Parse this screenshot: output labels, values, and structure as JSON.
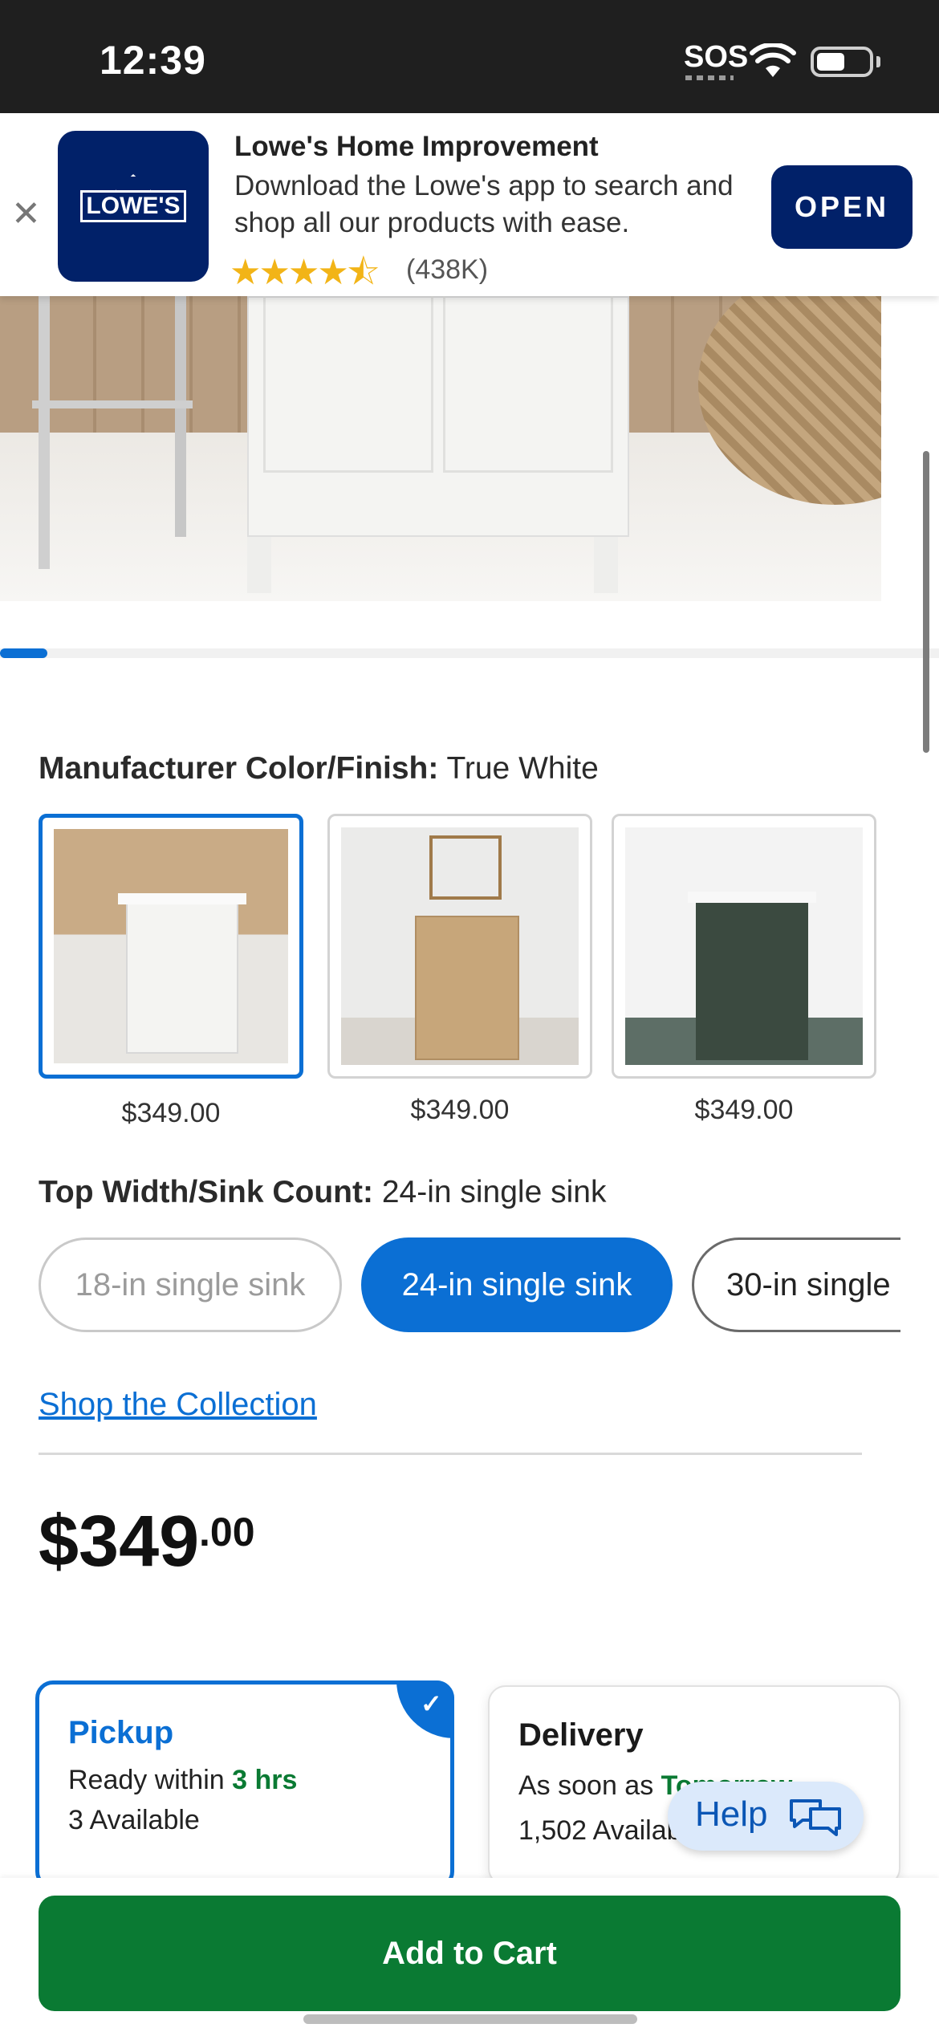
{
  "status_bar": {
    "time": "12:39",
    "sos": "SOS"
  },
  "app_banner": {
    "close": "✕",
    "logo_text": "LOWE'S",
    "title": "Lowe's Home Improvement",
    "description": "Download the Lowe's app to search and shop all our products with ease.",
    "stars": "★★★★⯪",
    "rating": 4.5,
    "rating_count": "(438K)",
    "open_label": "OPEN"
  },
  "gallery": {
    "position_fraction": 0.05
  },
  "color_option": {
    "label": "Manufacturer Color/Finish:",
    "value": "True White",
    "swatches": [
      {
        "price": "$349.00",
        "color": "#f4f4f2",
        "selected": true
      },
      {
        "price": "$349.00",
        "color": "#c7a67a",
        "selected": false
      },
      {
        "price": "$349.00",
        "color": "#3b4a40",
        "selected": false
      }
    ]
  },
  "size_option": {
    "label": "Top Width/Sink Count:",
    "value": "24-in single sink",
    "pills": [
      {
        "label": "18-in single sink",
        "state": "disabled"
      },
      {
        "label": "24-in single sink",
        "state": "selected"
      },
      {
        "label": "30-in single",
        "state": "available"
      }
    ]
  },
  "collection_link": "Shop the Collection",
  "price": {
    "dollars": "$349",
    "cents": ".00"
  },
  "pickup": {
    "title": "Pickup",
    "ready_prefix": "Ready within ",
    "ready_time": "3 hrs",
    "available": "3 Available"
  },
  "delivery": {
    "title": "Delivery",
    "soon_prefix": "As soon as ",
    "soon_value": "Tomorrow",
    "available": "1,502 Available"
  },
  "help": {
    "label": "Help"
  },
  "add_to_cart": "Add to Cart",
  "colors": {
    "accent": "#0b6fd4",
    "brand_navy": "#012169",
    "cta_green": "#0a7a33"
  }
}
